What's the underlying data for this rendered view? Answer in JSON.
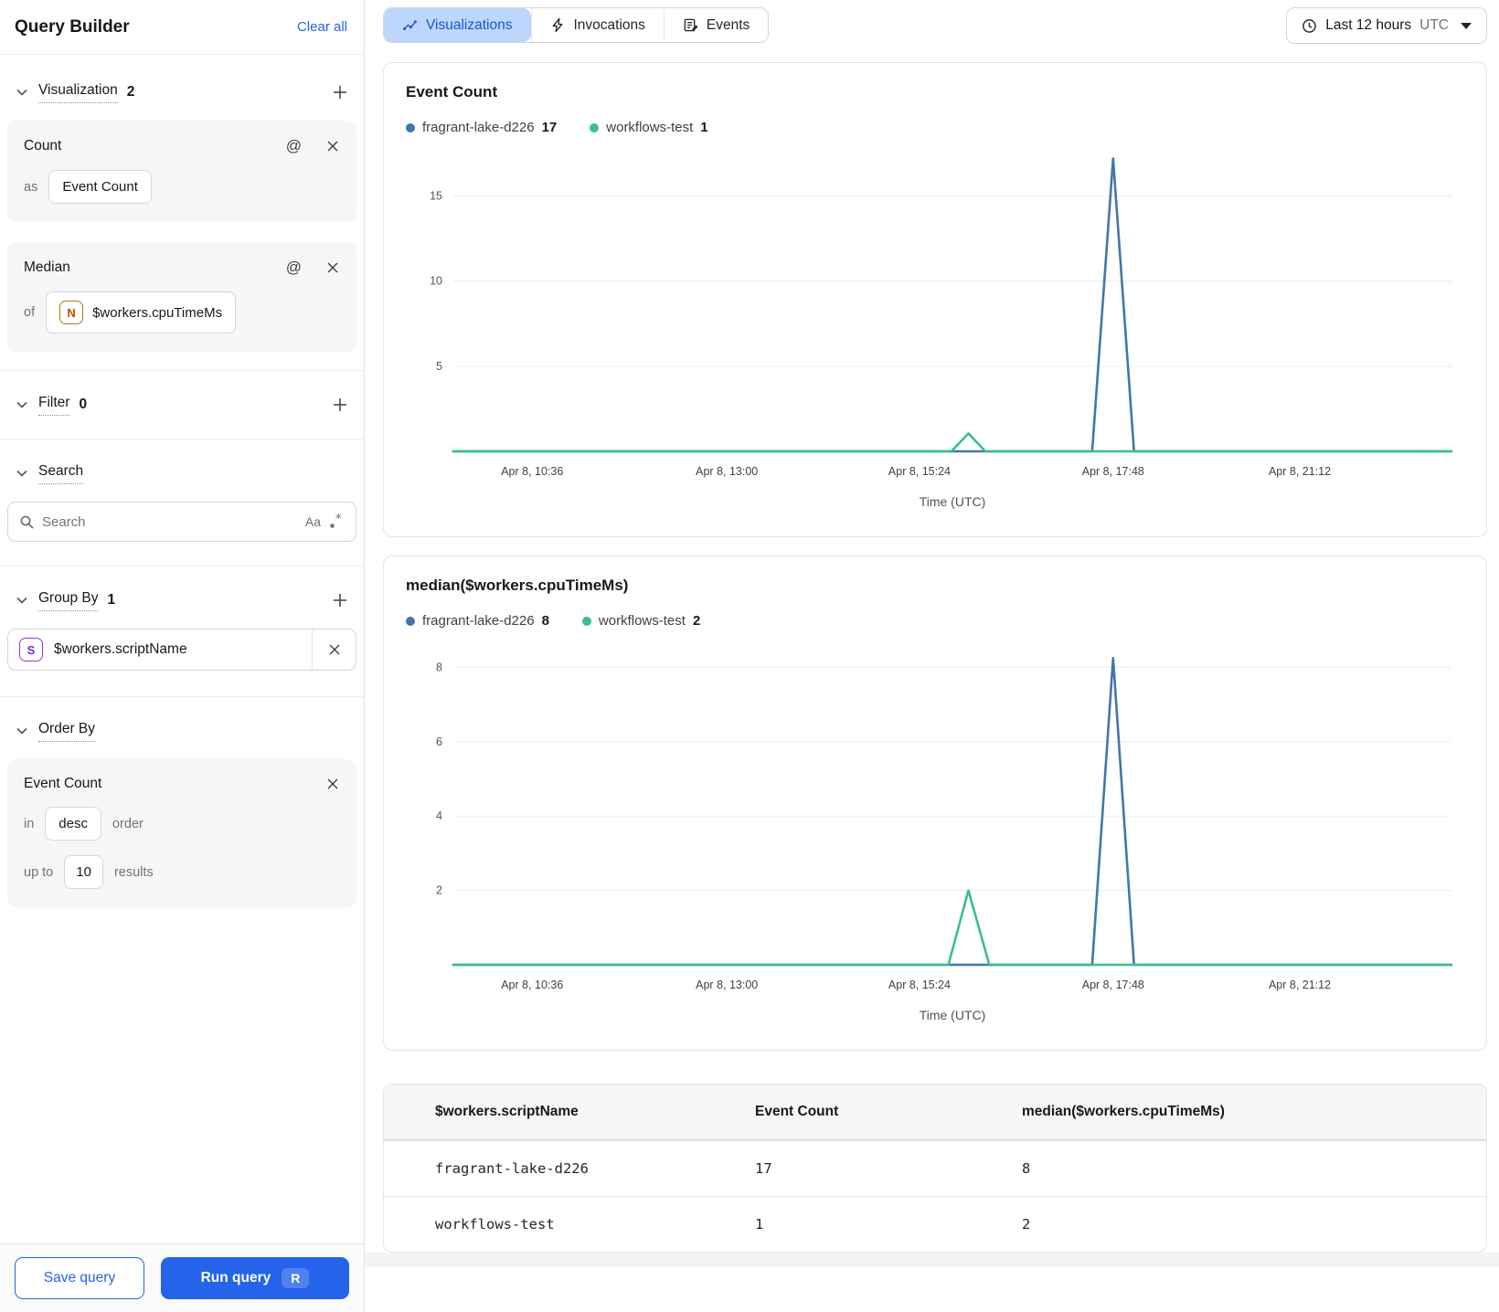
{
  "colors": {
    "series_blue": "#4377a8",
    "series_green": "#3bbe8d",
    "accent_blue": "#2563eb",
    "active_tab_bg": "#bdd6fc",
    "active_tab_text": "#1a56db"
  },
  "sidebar": {
    "title": "Query Builder",
    "clear_all": "Clear all",
    "sections": {
      "visualization": {
        "label": "Visualization",
        "count": "2"
      },
      "filter": {
        "label": "Filter",
        "count": "0"
      },
      "search": {
        "label": "Search"
      },
      "group_by": {
        "label": "Group By",
        "count": "1"
      },
      "order_by": {
        "label": "Order By"
      }
    },
    "count_card": {
      "title": "Count",
      "as_label": "as",
      "value": "Event Count"
    },
    "median_card": {
      "title": "Median",
      "of_label": "of",
      "badge": "N",
      "value": "$workers.cpuTimeMs"
    },
    "search": {
      "placeholder": "Search",
      "match_case_icon": "Aa"
    },
    "group_by_item": {
      "badge": "S",
      "value": "$workers.scriptName"
    },
    "order_card": {
      "field": "Event Count",
      "in_label": "in",
      "direction": "desc",
      "order_label": "order",
      "up_to_label": "up to",
      "limit": "10",
      "results_label": "results"
    },
    "footer": {
      "save": "Save query",
      "run": "Run query",
      "shortcut": "R"
    }
  },
  "topbar": {
    "tabs": [
      {
        "label": "Visualizations",
        "active": true
      },
      {
        "label": "Invocations",
        "active": false
      },
      {
        "label": "Events",
        "active": false
      }
    ],
    "time_range": {
      "label": "Last 12 hours",
      "timezone": "UTC"
    }
  },
  "chart_data": [
    {
      "type": "line",
      "title": "Event Count",
      "xlabel": "Time (UTC)",
      "ylim": [
        0,
        17.6
      ],
      "yticks": [
        5,
        10,
        15
      ],
      "grid": "horizontal",
      "xticks": [
        {
          "label": "Apr 8, 10:36",
          "pos": 0.079
        },
        {
          "label": "Apr 8, 13:00",
          "pos": 0.274
        },
        {
          "label": "Apr 8, 15:24",
          "pos": 0.467
        },
        {
          "label": "Apr 8, 17:48",
          "pos": 0.661
        },
        {
          "label": "Apr 8, 21:12",
          "pos": 0.848
        }
      ],
      "legend": [
        {
          "name": "fragrant-lake-d226",
          "value": "17",
          "color": "#4377a8"
        },
        {
          "name": "workflows-test",
          "value": "1",
          "color": "#3bbe8d"
        }
      ],
      "series": [
        {
          "name": "fragrant-lake-d226",
          "color": "#4377a8",
          "points": [
            [
              0,
              0
            ],
            [
              0.64,
              0
            ],
            [
              0.661,
              17.2
            ],
            [
              0.682,
              0
            ],
            [
              1,
              0
            ]
          ]
        },
        {
          "name": "workflows-test",
          "color": "#3bbe8d",
          "points": [
            [
              0,
              0
            ],
            [
              0.499,
              0
            ],
            [
              0.516,
              1.05
            ],
            [
              0.533,
              0
            ],
            [
              1,
              0
            ]
          ]
        }
      ]
    },
    {
      "type": "line",
      "title": "median($workers.cpuTimeMs)",
      "xlabel": "Time (UTC)",
      "ylim": [
        0,
        8.6
      ],
      "yticks": [
        2,
        4,
        6,
        8
      ],
      "grid": "horizontal",
      "xticks": [
        {
          "label": "Apr 8, 10:36",
          "pos": 0.079
        },
        {
          "label": "Apr 8, 13:00",
          "pos": 0.274
        },
        {
          "label": "Apr 8, 15:24",
          "pos": 0.467
        },
        {
          "label": "Apr 8, 17:48",
          "pos": 0.661
        },
        {
          "label": "Apr 8, 21:12",
          "pos": 0.848
        }
      ],
      "legend": [
        {
          "name": "fragrant-lake-d226",
          "value": "8",
          "color": "#4377a8"
        },
        {
          "name": "workflows-test",
          "value": "2",
          "color": "#3bbe8d"
        }
      ],
      "series": [
        {
          "name": "fragrant-lake-d226",
          "color": "#4377a8",
          "points": [
            [
              0,
              0
            ],
            [
              0.64,
              0
            ],
            [
              0.661,
              8.25
            ],
            [
              0.682,
              0
            ],
            [
              1,
              0
            ]
          ]
        },
        {
          "name": "workflows-test",
          "color": "#3bbe8d",
          "points": [
            [
              0,
              0
            ],
            [
              0.496,
              0
            ],
            [
              0.516,
              2
            ],
            [
              0.537,
              0
            ],
            [
              1,
              0
            ]
          ]
        }
      ]
    }
  ],
  "table": {
    "headers": [
      "$workers.scriptName",
      "Event Count",
      "median($workers.cpuTimeMs)"
    ],
    "rows": [
      {
        "color": "#4377a8",
        "name": "fragrant-lake-d226",
        "event_count": "17",
        "median": "8"
      },
      {
        "color": "#3bbe8d",
        "name": "workflows-test",
        "event_count": "1",
        "median": "2"
      }
    ]
  }
}
